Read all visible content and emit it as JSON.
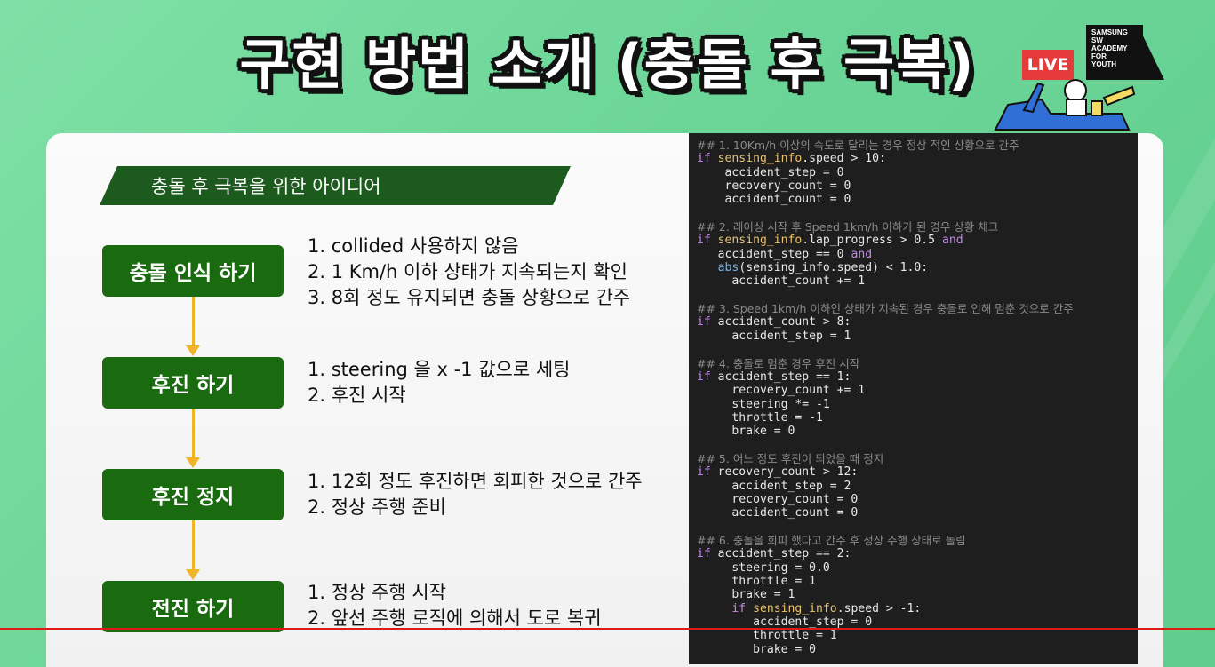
{
  "title": "구현 방법 소개 (충돌 후 극복)",
  "badges": {
    "live": "LIVE",
    "samsung_lines": [
      "SAMSUNG",
      "SW",
      "ACADEMY",
      "FOR",
      "YOUTH"
    ]
  },
  "banner": "충돌 후 극복을 위한 아이디어",
  "steps": [
    {
      "label": "충돌 인식 하기",
      "items": [
        "1.  collided 사용하지 않음",
        "2.  1 Km/h 이하 상태가 지속되는지 확인",
        "3.  8회 정도 유지되면 충돌 상황으로 간주"
      ]
    },
    {
      "label": "후진 하기",
      "items": [
        "1.  steering 을 x -1 값으로 세팅",
        "2.  후진 시작"
      ]
    },
    {
      "label": "후진 정지",
      "items": [
        "1.  12회 정도 후진하면 회피한 것으로 간주",
        "2.  정상 주행 준비"
      ]
    },
    {
      "label": "전진 하기",
      "items": [
        "1. 정상 주행 시작",
        "2. 앞선 주행 로직에 의해서 도로 복귀"
      ]
    }
  ],
  "code_lines": [
    [
      [
        "c",
        "## 1. 10Km/h 이상의 속도로 달리는 경우 정상 적인 상황으로 간주"
      ]
    ],
    [
      [
        "k",
        "if "
      ],
      [
        "v",
        "sensing_info"
      ],
      [
        "p",
        ".speed > 10:"
      ]
    ],
    [
      [
        "p",
        "    accident_step = 0"
      ]
    ],
    [
      [
        "p",
        "    recovery_count = 0"
      ]
    ],
    [
      [
        "p",
        "    accident_count = 0"
      ]
    ],
    [
      [
        "p",
        ""
      ]
    ],
    [
      [
        "c",
        "## 2. 레이싱 시작 후 Speed 1km/h 이하가 된 경우 상황 체크"
      ]
    ],
    [
      [
        "k",
        "if "
      ],
      [
        "v",
        "sensing_info"
      ],
      [
        "p",
        ".lap_progress > 0.5 "
      ],
      [
        "k",
        "and"
      ]
    ],
    [
      [
        "p",
        "   accident_step == 0 "
      ],
      [
        "k",
        "and"
      ]
    ],
    [
      [
        "p",
        "   "
      ],
      [
        "f",
        "abs"
      ],
      [
        "p",
        "(sensing_info.speed) < 1.0:"
      ]
    ],
    [
      [
        "p",
        "     accident_count += 1"
      ]
    ],
    [
      [
        "p",
        ""
      ]
    ],
    [
      [
        "c",
        "## 3. Speed 1km/h 이하인 상태가 지속된 경우 충돌로 인해 멈춘 것으로 간주"
      ]
    ],
    [
      [
        "k",
        "if "
      ],
      [
        "p",
        "accident_count > 8:"
      ]
    ],
    [
      [
        "p",
        "     accident_step = 1"
      ]
    ],
    [
      [
        "p",
        ""
      ]
    ],
    [
      [
        "c",
        "## 4. 충돌로 멈춘 경우 후진 시작"
      ]
    ],
    [
      [
        "k",
        "if "
      ],
      [
        "p",
        "accident_step == 1:"
      ]
    ],
    [
      [
        "p",
        "     recovery_count += 1"
      ]
    ],
    [
      [
        "p",
        "     steering *= -1"
      ]
    ],
    [
      [
        "p",
        "     throttle = -1"
      ]
    ],
    [
      [
        "p",
        "     brake = 0"
      ]
    ],
    [
      [
        "p",
        ""
      ]
    ],
    [
      [
        "c",
        "## 5. 어느 정도 후진이 되었을 때 정지"
      ]
    ],
    [
      [
        "k",
        "if "
      ],
      [
        "p",
        "recovery_count > 12:"
      ]
    ],
    [
      [
        "p",
        "     accident_step = 2"
      ]
    ],
    [
      [
        "p",
        "     recovery_count = 0"
      ]
    ],
    [
      [
        "p",
        "     accident_count = 0"
      ]
    ],
    [
      [
        "p",
        ""
      ]
    ],
    [
      [
        "c",
        "## 6. 충돌을 회피 했다고 간주 후 정상 주행 상태로 돌림"
      ]
    ],
    [
      [
        "k",
        "if "
      ],
      [
        "p",
        "accident_step == 2:"
      ]
    ],
    [
      [
        "p",
        "     steering = 0.0"
      ]
    ],
    [
      [
        "p",
        "     throttle = 1"
      ]
    ],
    [
      [
        "p",
        "     brake = 1"
      ]
    ],
    [
      [
        "p",
        "     "
      ],
      [
        "k",
        "if "
      ],
      [
        "v",
        "sensing_info"
      ],
      [
        "p",
        ".speed > -1:"
      ]
    ],
    [
      [
        "p",
        "        accident_step = 0"
      ]
    ],
    [
      [
        "p",
        "        throttle = 1"
      ]
    ],
    [
      [
        "p",
        "        brake = 0"
      ]
    ]
  ],
  "icons": {
    "kart": "kart-mascot-icon"
  },
  "colors": {
    "step_green": "#1a6b0f",
    "arrow": "#f0b428",
    "banner": "#1d5a1d",
    "live": "#e63b3b"
  }
}
